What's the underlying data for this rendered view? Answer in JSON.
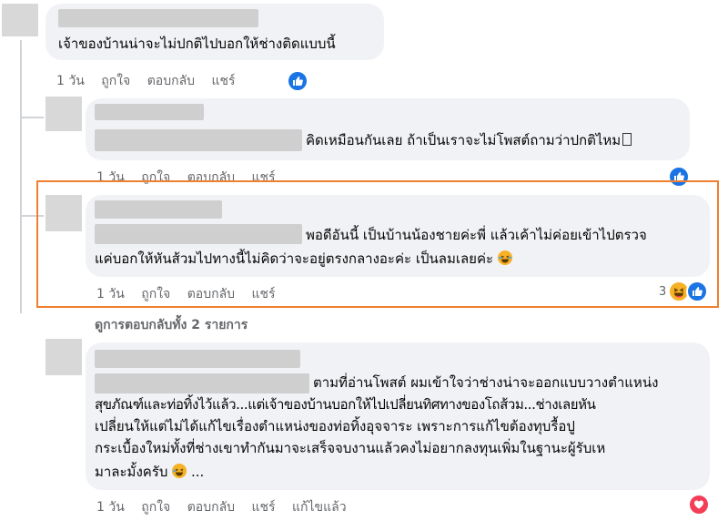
{
  "comments": [
    {
      "text_lines": [
        "เจ้าของบ้านน่าจะไม่ปกติไปบอกให้ช่างติดแบบนี้"
      ],
      "time": "1 วัน",
      "like": "ถูกใจ",
      "reply": "ตอบกลับ",
      "share": "แชร์"
    },
    {
      "text_lines": [
        "คิดเหมือนกันเลย ถ้าเป็นเราจะไม่โพสต์ถามว่าปกติไหม"
      ],
      "time": "1 วัน",
      "like": "ถูกใจ",
      "reply": "ตอบกลับ",
      "share": "แชร์"
    },
    {
      "text_lines": [
        "พอดีอันนี้ เป็นบ้านน้องชายค่ะพี่ แล้วเค้าไม่ค่อยเข้าไปตรวจ",
        "แค่บอกให้หันส้วมไปทางนี้ไม่คิดว่าจะอยู่ตรงกลางอะค่ะ เป็นลมเลยค่ะ"
      ],
      "time": "1 วัน",
      "like": "ถูกใจ",
      "reply": "ตอบกลับ",
      "share": "แชร์",
      "reaction_count": "3"
    },
    {
      "text_lines": [
        "ตามที่อ่านโพสต์ ผมเข้าใจว่าช่างน่าจะออกแบบวางตำแหน่ง",
        "สุขภัณฑ์และท่อทิ้งไว้แล้ว...แต่เจ้าของบ้านบอกให้ไปเปลี่ยนทิศทางของโถส้วม...ช่างเลยหัน",
        "เปลี่ยนให้แต่ไม่ได้แก้ไขเรื่องตำแหน่งของท่อทิ้งอุจจาระ เพราะการแก้ไขต้องทุบรื้อปู",
        "กระเบื้องใหม่ทั้งที่ช่างเขาทำกันมาจะเสร็จจบงานแล้วคงไม่อยากลงทุนเพิ่มในฐานะผู้รับเห",
        "มาละมั้งครับ",
        "..."
      ],
      "time": "1 วัน",
      "like": "ถูกใจ",
      "reply": "ตอบกลับ",
      "share": "แชร์",
      "edited": "แก้ไขแล้ว"
    }
  ],
  "view_replies": "ดูการตอบกลับทั้ง 2 รายการ",
  "colors": {
    "bubble": "#f0f2f5",
    "highlight": "#f07f2e",
    "like": "#1b74e4",
    "love": "#f33e58",
    "haha": "#f7b125"
  },
  "icons": [
    "like-reaction-icon",
    "haha-reaction-icon",
    "love-reaction-icon",
    "laughing-emoji-icon",
    "grinning-emoji-icon"
  ]
}
